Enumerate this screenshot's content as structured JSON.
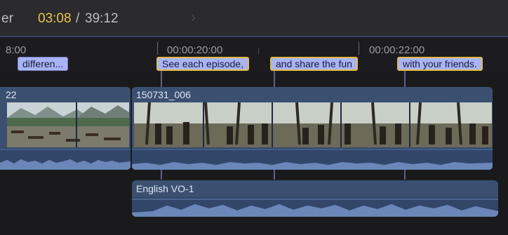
{
  "header": {
    "tab_label": "er",
    "current_time": "03:08",
    "separator": "/",
    "total_time": "39:12",
    "forward_icon": "chevron-right-icon"
  },
  "ruler": {
    "labels": [
      "8:00",
      "00:00:20:00",
      "00:00:22:00"
    ]
  },
  "captions": [
    {
      "text": "differen...",
      "selected": false
    },
    {
      "text": "See each episode,",
      "selected": true
    },
    {
      "text": "and share the fun",
      "selected": true
    },
    {
      "text": "with your friends.",
      "selected": true
    }
  ],
  "clips": {
    "left_clip_name": "22",
    "main_clip_name": "150731_006",
    "audio_clip_name": "English VO-1"
  },
  "colors": {
    "accent_timecode": "#e8c44a",
    "caption_fill": "#a9b4f7",
    "caption_selected_border": "#e2bd45",
    "clip_blue": "#3b5071"
  }
}
